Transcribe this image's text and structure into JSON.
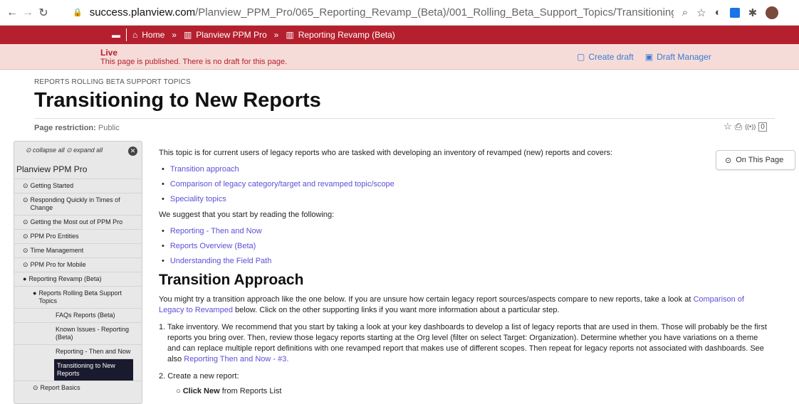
{
  "browser": {
    "url_domain": "success.planview.com",
    "url_path": "/Planview_PPM_Pro/065_Reporting_Revamp_(Beta)/001_Rolling_Beta_Support_Topics/Transitioning_to_New_Reports#About_Speci..."
  },
  "topbar": {
    "home": "Home",
    "crumb1": "Planview PPM Pro",
    "crumb2": "Reporting Revamp (Beta)",
    "separator": "»"
  },
  "status": {
    "state": "Live",
    "message": "This page is published. There is no draft for this page.",
    "create_draft": "Create draft",
    "draft_manager": "Draft Manager"
  },
  "header": {
    "overline": "REPORTS ROLLING BETA SUPPORT TOPICS",
    "title": "Transitioning to New Reports",
    "restriction_label": "Page restriction:",
    "restriction_value": "Public",
    "comment_count": "0"
  },
  "sidebar": {
    "collapse_all": "collapse all",
    "expand_all": "expand all",
    "root": "Planview PPM Pro",
    "items": [
      {
        "label": "Getting Started"
      },
      {
        "label": "Responding Quickly in Times of Change"
      },
      {
        "label": "Getting the Most out of PPM Pro"
      },
      {
        "label": "PPM Pro Entities"
      },
      {
        "label": "Time Management"
      },
      {
        "label": "PPM Pro for Mobile"
      },
      {
        "label": "Reporting Revamp (Beta)"
      },
      {
        "label": "Reports Rolling Beta Support Topics"
      },
      {
        "label": "FAQs Reports (Beta)"
      },
      {
        "label": "Known Issues - Reporting (Beta)"
      },
      {
        "label": "Reporting - Then and Now"
      },
      {
        "label": "Transitioning to New Reports"
      },
      {
        "label": "Report Basics"
      }
    ]
  },
  "content": {
    "intro": "This topic is for current users of legacy reports who are tasked with developing an inventory of revamped (new) reports and covers:",
    "intro_links": [
      "Transition approach",
      "Comparison of legacy category/target and revamped topic/scope",
      "Speciality topics"
    ],
    "suggest": "We suggest that you start by reading the following:",
    "suggest_links": [
      "Reporting - Then and Now",
      "Reports Overview (Beta)",
      "Understanding the Field Path"
    ],
    "section_title": "Transition Approach",
    "section_text_a": "You might try a transition approach like the one below. If you are unsure how certain legacy report sources/aspects compare to new reports, take a look at ",
    "section_link": "Comparison of Legacy to Revamped",
    "section_text_b": " below. Click on the other supporting links if you want more information about a particular step.",
    "step1_text": "1. Take inventory. We recommend that you start by taking a look at your key dashboards to develop a list of legacy reports that are used in them. Those will probably be the first reports you bring over. Then, review those legacy reports starting at the Org level (filter on select Target: Organization). Determine whether you have variations on a theme and can replace multiple report definitions with one revamped report that makes use of different scopes. Then repeat for legacy reports not associated with dashboards. See also ",
    "step1_link": "Reporting Then and Now - #3.",
    "step2_text": "2. Create a new report:",
    "step2_sub_bold": "Click New",
    "step2_sub_rest": " from Reports List"
  },
  "on_this_page": "On This Page"
}
